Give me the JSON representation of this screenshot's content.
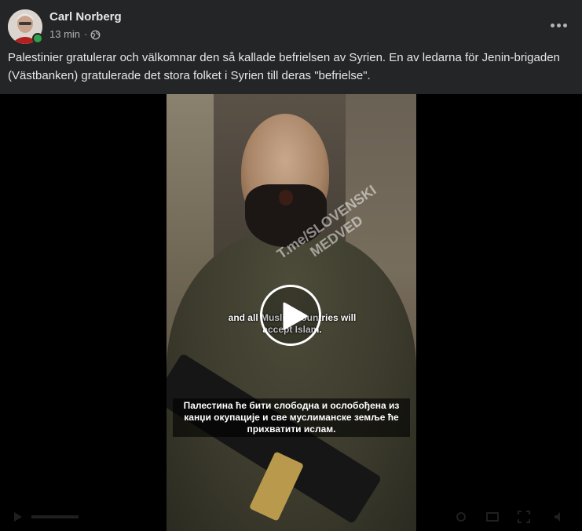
{
  "post": {
    "author": "Carl Norberg",
    "time": "13 min",
    "separator": "·",
    "audience_icon": "globe-icon",
    "text": "Palestinier gratulerar och välkomnar den så kallade befrielsen av Syrien. En av ledarna för Jenin-brigaden (Västbanken) gratulerade det stora folket i Syrien till deras \"befrielse\"."
  },
  "video": {
    "watermark": "T.me/SLOVENSKI MEDVED",
    "subtitle_en": "and all Muslim countries will accept Islam.",
    "subtitle_ru": "Палестина ће бити слободна и ослобођена из канџи окупације и све муслиманске земље ће прихватити ислам.",
    "play_icon": "play-icon"
  },
  "colors": {
    "background": "#242526",
    "text": "#e4e6eb",
    "secondary_text": "#b0b3b8",
    "online": "#31a24c"
  }
}
